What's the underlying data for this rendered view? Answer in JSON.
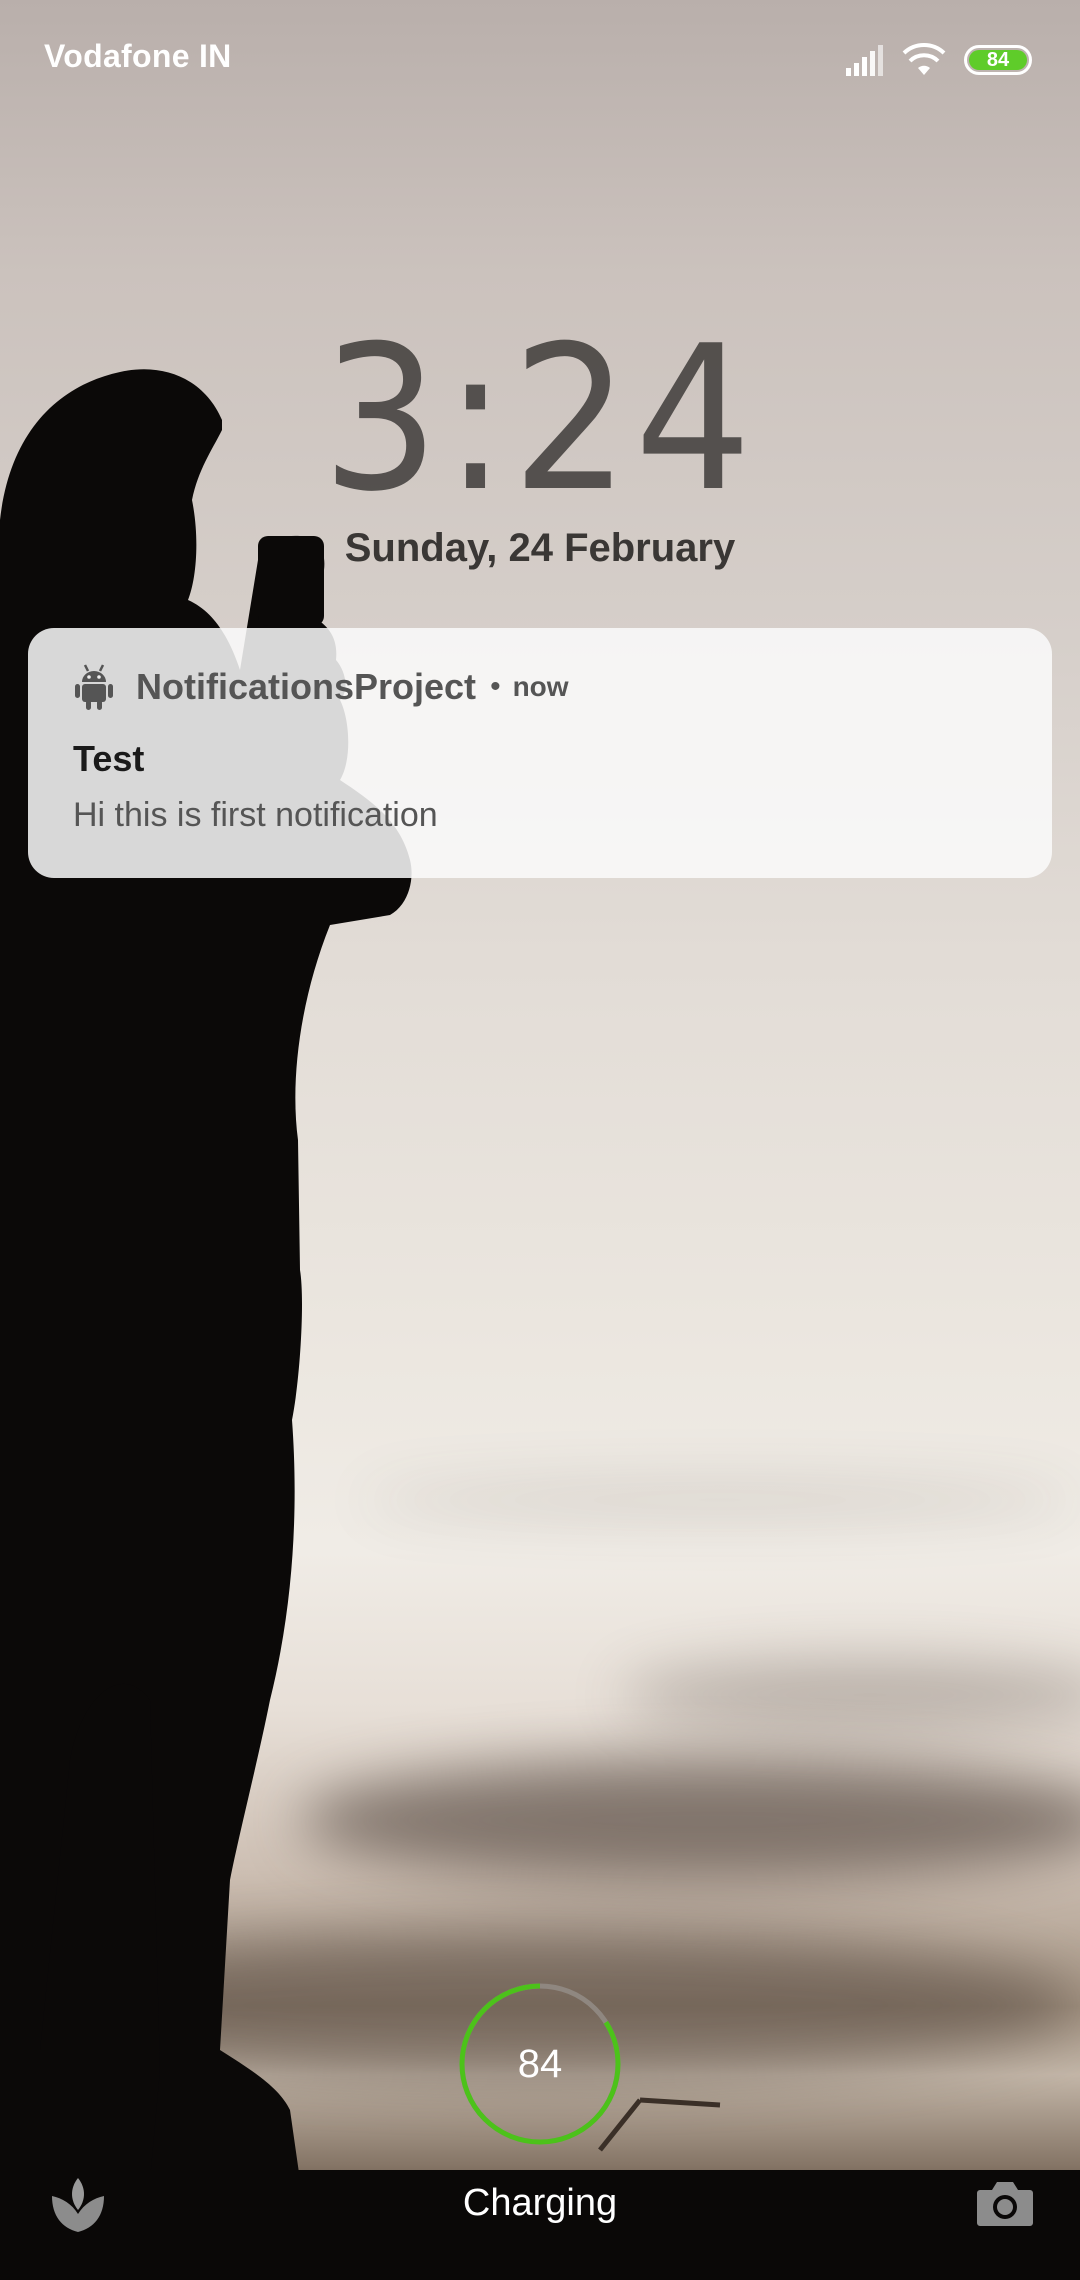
{
  "status_bar": {
    "carrier": "Vodafone IN",
    "battery_level": "84",
    "icons": [
      "signal-icon",
      "wifi-icon",
      "battery-icon"
    ],
    "battery_color": "#5fcc2a"
  },
  "lockscreen": {
    "time": "3:24",
    "date": "Sunday, 24 February"
  },
  "notification": {
    "app_icon": "android-icon",
    "app_name": "NotificationsProject",
    "separator": "•",
    "time": "now",
    "title": "Test",
    "text": "Hi this is first notification"
  },
  "charging": {
    "percent": "84",
    "ring_fraction": 0.84,
    "ring_color": "#4cc21a",
    "label": "Charging"
  },
  "shortcuts": {
    "left_icon": "lotus-icon",
    "right_icon": "camera-icon"
  }
}
